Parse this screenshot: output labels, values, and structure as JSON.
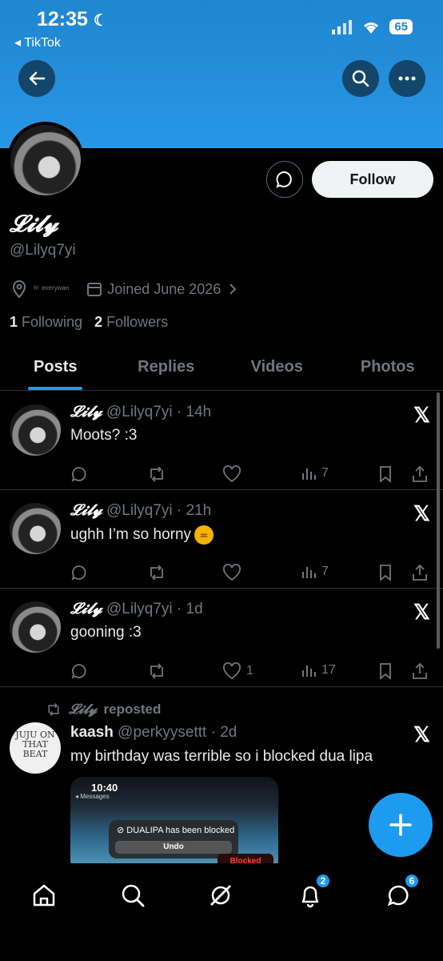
{
  "status_bar": {
    "time": "12:35",
    "back_app": "◂ TikTok",
    "battery": "65"
  },
  "profile": {
    "display_name": "𝓛𝓲𝓵𝔂",
    "handle": "@Lilyq7yi",
    "location": "ʰⁱ ᵉᵛᵉʳʸʷᵃⁿ",
    "joined": "Joined June 2026",
    "following_count": "1",
    "following_label": "Following",
    "followers_count": "2",
    "followers_label": "Followers",
    "follow_label": "Follow"
  },
  "tabs": [
    {
      "label": "Posts",
      "active": true
    },
    {
      "label": "Replies"
    },
    {
      "label": "Videos"
    },
    {
      "label": "Photos"
    }
  ],
  "posts": [
    {
      "name": "𝓛𝓲𝓵𝔂",
      "handle": "@Lilyq7yi",
      "time": "14h",
      "text": "Moots? :3",
      "likes": "",
      "views": "7"
    },
    {
      "name": "𝓛𝓲𝓵𝔂",
      "handle": "@Lilyq7yi",
      "time": "21h",
      "text": "ughh I’m so horny",
      "likes": "",
      "views": "7"
    },
    {
      "name": "𝓛𝓲𝓵𝔂",
      "handle": "@Lilyq7yi",
      "time": "1d",
      "text": "gooning :3",
      "likes": "1",
      "views": "17"
    }
  ],
  "repost": {
    "repost_by": "𝓛𝓲𝓵𝔂",
    "repost_suffix": "reposted",
    "avatar_text": "JUJU ON THAT BEAT",
    "name": "kaash",
    "handle": "@perkyysettt",
    "time": "2d",
    "text": "my birthday was terrible so i blocked dua lipa",
    "media": {
      "time": "10:40",
      "messages_label": "◂ Messages",
      "toast": "DUALIPA has been blocked",
      "undo": "Undo",
      "blocked": "Blocked"
    }
  },
  "nav": {
    "notifications_badge": "2",
    "messages_badge": "6"
  },
  "colors": {
    "accent": "#1d9bf0",
    "banner": "#2896e6",
    "background": "#000000",
    "muted": "#71767b"
  }
}
